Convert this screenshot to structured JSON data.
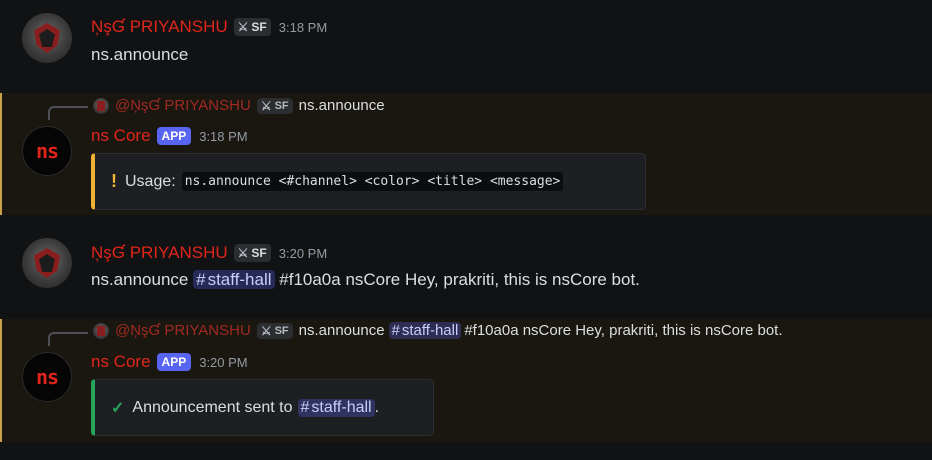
{
  "colors": {
    "username": "#e1251b",
    "app_badge": "#5865f2",
    "warn_bar": "#f0b232",
    "ok_bar": "#23a55a",
    "mention_bg": "#3a3f6e"
  },
  "messages": [
    {
      "type": "user",
      "username": "ŅşƓ PRIYANSHU",
      "tag": "SF",
      "tag_icon": "sword-icon",
      "time": "3:18 PM",
      "content": "ns.announce"
    },
    {
      "type": "bot",
      "reply": {
        "user": "@ŅşƓ PRIYANSHU",
        "tag": "SF",
        "text": "ns.announce"
      },
      "username": "ns Core",
      "badge": "APP",
      "time": "3:18 PM",
      "embed": {
        "icon": "!",
        "label": "Usage:",
        "code": "ns.announce <#channel> <color> <title> <message>"
      }
    },
    {
      "type": "user",
      "username": "ŅşƓ PRIYANSHU",
      "tag": "SF",
      "time": "3:20 PM",
      "content_pre": "ns.announce",
      "channel": "staff-hall",
      "content_post": "#f10a0a nsCore Hey, prakriti, this is nsCore bot."
    },
    {
      "type": "bot",
      "reply": {
        "user": "@ŅşƓ PRIYANSHU",
        "tag": "SF",
        "text_pre": "ns.announce",
        "channel": "staff-hall",
        "text_post": "#f10a0a nsCore Hey, prakriti, this is nsCore bot."
      },
      "username": "ns Core",
      "badge": "APP",
      "time": "3:20 PM",
      "embed": {
        "icon": "✓",
        "text": "Announcement sent to",
        "channel": "staff-hall",
        "suffix": "."
      }
    }
  ],
  "bot_avatar_text": "ns"
}
